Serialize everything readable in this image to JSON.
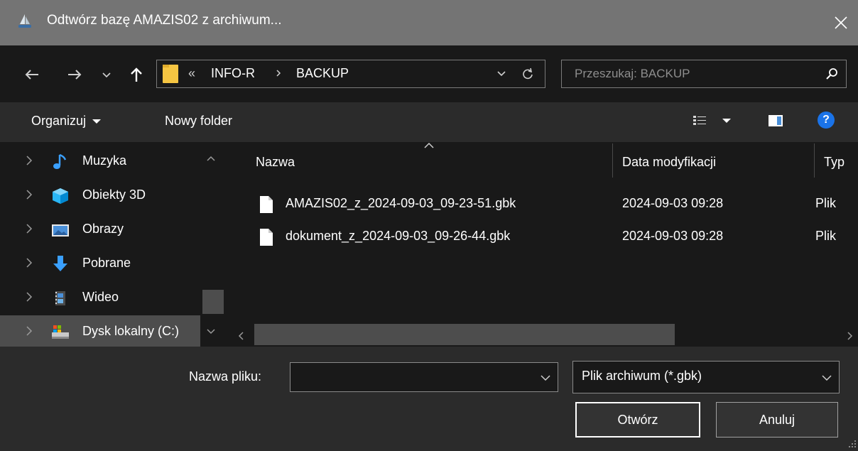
{
  "window": {
    "title": "Odtwórz bazę AMAZIS02 z archiwum..."
  },
  "address": {
    "overflow": "«",
    "path": [
      "INFO-R",
      "BACKUP"
    ]
  },
  "search": {
    "placeholder": "Przeszukaj: BACKUP"
  },
  "toolbar": {
    "organize_label": "Organizuj",
    "new_folder_label": "Nowy folder",
    "help_label": "?"
  },
  "nav_pane": {
    "items": [
      {
        "label": "Muzyka",
        "icon": "music-icon"
      },
      {
        "label": "Obiekty 3D",
        "icon": "3d-objects-icon"
      },
      {
        "label": "Obrazy",
        "icon": "pictures-icon"
      },
      {
        "label": "Pobrane",
        "icon": "downloads-icon"
      },
      {
        "label": "Wideo",
        "icon": "video-icon"
      },
      {
        "label": "Dysk lokalny (C:)",
        "icon": "local-disk-icon"
      }
    ]
  },
  "columns": {
    "name": "Nazwa",
    "date": "Data modyfikacji",
    "type": "Typ"
  },
  "files": [
    {
      "name": "AMAZIS02_z_2024-09-03_09-23-51.gbk",
      "date": "2024-09-03 09:28",
      "type": "Plik"
    },
    {
      "name": "dokument_z_2024-09-03_09-26-44.gbk",
      "date": "2024-09-03 09:28",
      "type": "Plik"
    }
  ],
  "bottom": {
    "filename_label": "Nazwa pliku:",
    "filename_value": "",
    "filter_value": "Plik archiwum (*.gbk)",
    "open_label": "Otwórz",
    "cancel_label": "Anuluj"
  },
  "colors": {
    "titlebar": "#747474",
    "background": "#191919",
    "toolbar": "#2b2b2b",
    "help": "#1a73e8",
    "folder": "#f5c542"
  }
}
